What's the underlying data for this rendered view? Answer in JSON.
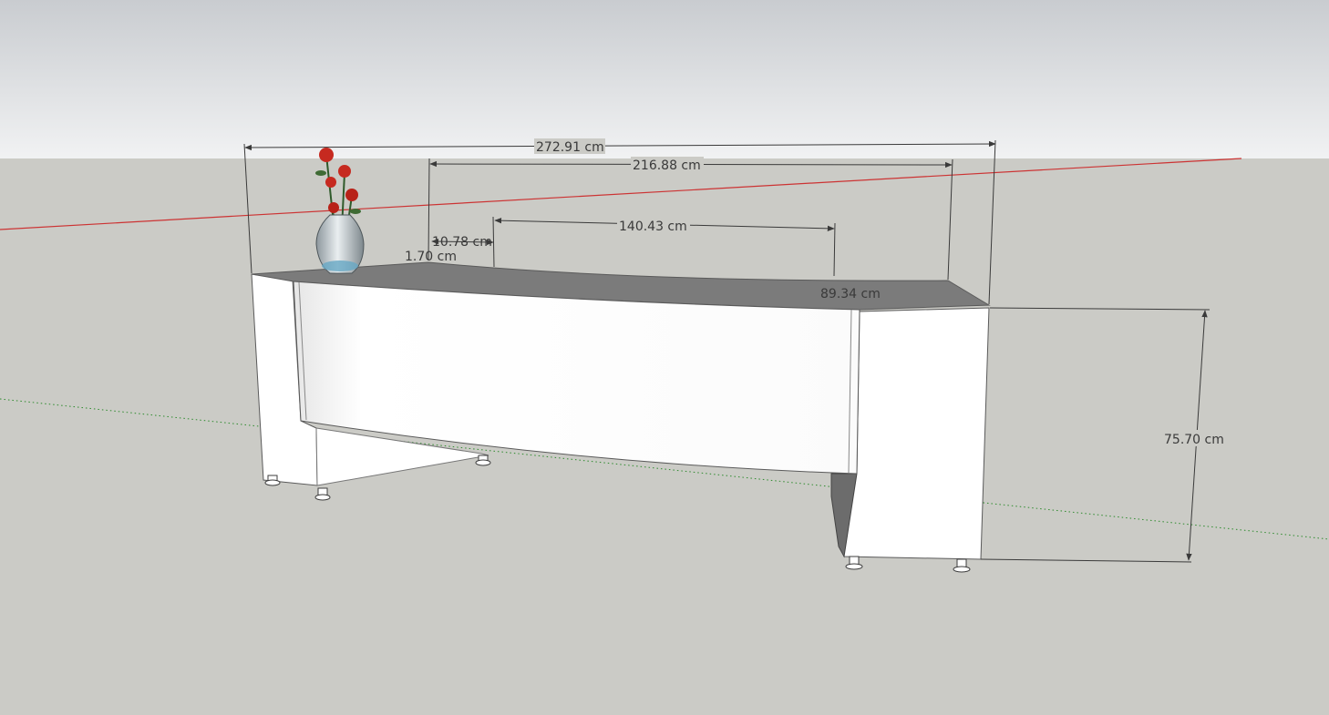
{
  "colors": {
    "sky_top": "#c9ccd0",
    "sky_bottom": "#f1f2f3",
    "ground": "#cbcbc6",
    "desk_top": "#7b7b7b",
    "desk_face": "#ffffff",
    "desk_side": "#f4f4f4",
    "dimension_line": "#3a3a3a",
    "red_axis": "#cc3333",
    "green_axis": "#2e8b2e"
  },
  "dimensions": {
    "overall_width": "272.91 cm",
    "inner_width": "216.88 cm",
    "panel_width": "140.43 cm",
    "offset_a": "10.78 cm",
    "offset_b": "1.70 cm",
    "depth": "89.34 cm",
    "height": "75.70 cm"
  },
  "scene": {
    "objects": [
      "curved-reception-desk",
      "flower-vase"
    ],
    "icons": [
      "vase-icon",
      "flower-icon"
    ]
  }
}
